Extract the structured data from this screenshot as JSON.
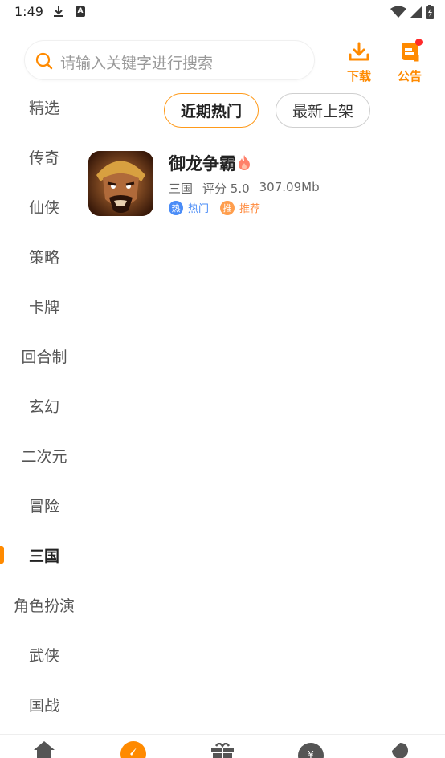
{
  "status_bar": {
    "time": "1:49"
  },
  "header": {
    "search_placeholder": "请输入关键字进行搜索",
    "download_label": "下载",
    "notice_label": "公告"
  },
  "sidebar": {
    "categories": [
      {
        "label": "精选"
      },
      {
        "label": "传奇"
      },
      {
        "label": "仙侠"
      },
      {
        "label": "策略"
      },
      {
        "label": "卡牌"
      },
      {
        "label": "回合制"
      },
      {
        "label": "玄幻"
      },
      {
        "label": "二次元"
      },
      {
        "label": "冒险"
      },
      {
        "label": "三国",
        "active": true
      },
      {
        "label": "角色扮演"
      },
      {
        "label": "武侠"
      },
      {
        "label": "国战"
      }
    ]
  },
  "tabs": {
    "hot": "近期热门",
    "new": "最新上架"
  },
  "games": [
    {
      "name": "御龙争霸",
      "category": "三国",
      "rating": "评分 5.0",
      "size": "307.09Mb",
      "tags": [
        {
          "badge": "热",
          "text": "热门"
        },
        {
          "badge": "推",
          "text": "推荐"
        }
      ]
    }
  ],
  "colors": {
    "accent": "#ff8a00",
    "hot_tag": "#4a8cf7",
    "rec_tag": "#ff9e4d"
  }
}
